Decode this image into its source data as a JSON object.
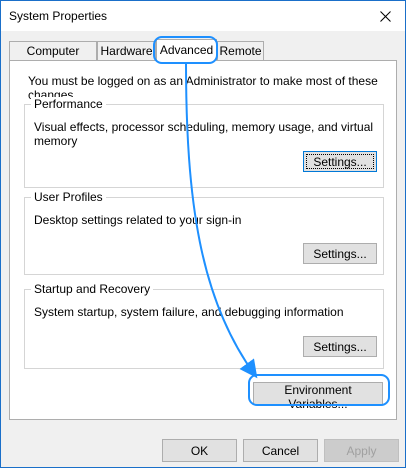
{
  "window": {
    "title": "System Properties"
  },
  "icons": {
    "close": "close-icon"
  },
  "tabs": [
    {
      "label": "Computer Name",
      "selected": false
    },
    {
      "label": "Hardware",
      "selected": false
    },
    {
      "label": "Advanced",
      "selected": true
    },
    {
      "label": "Remote",
      "selected": false
    }
  ],
  "advanced": {
    "admin_notice": "You must be logged on as an Administrator to make most of these changes.",
    "performance": {
      "title": "Performance",
      "description": "Visual effects, processor scheduling, memory usage, and virtual memory",
      "button": "Settings..."
    },
    "user_profiles": {
      "title": "User Profiles",
      "description": "Desktop settings related to your sign-in",
      "button": "Settings..."
    },
    "startup_recovery": {
      "title": "Startup and Recovery",
      "description": "System startup, system failure, and debugging information",
      "button": "Settings..."
    },
    "environment_variables_button": "Environment Variables..."
  },
  "footer": {
    "ok": "OK",
    "cancel": "Cancel",
    "apply": "Apply"
  },
  "annotation": {
    "color": "#1e90ff"
  }
}
